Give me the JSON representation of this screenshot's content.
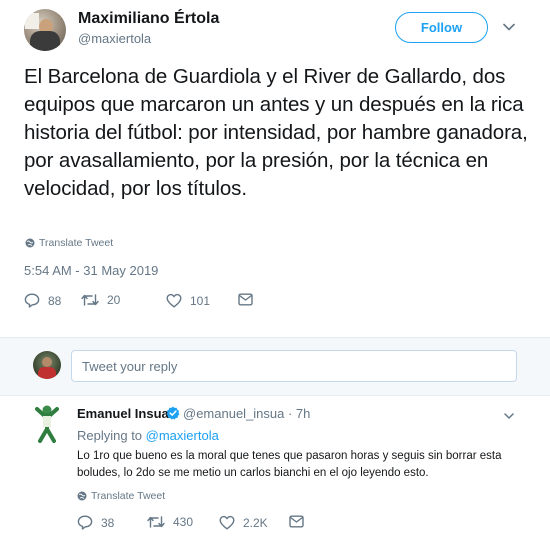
{
  "tweet": {
    "display_name": "Maximiliano Értola",
    "handle": "@maxiertola",
    "follow_label": "Follow",
    "text": "El Barcelona de Guardiola y el River de Gallardo, dos equipos que marcaron un antes y un después en la rica historia del fútbol: por intensidad, por hambre ganadora, por avasallamiento, por la presión, por la técnica en velocidad, por los títulos.",
    "translate_label": "Translate Tweet",
    "timestamp": "5:54 AM - 31 May 2019",
    "actions": {
      "replies": "88",
      "retweets": "20",
      "likes": "101"
    }
  },
  "reply_box": {
    "placeholder": "Tweet your reply"
  },
  "reply": {
    "display_name": "Emanuel Insua",
    "handle_time": "@emanuel_insua · 7h",
    "replying_prefix": "Replying to ",
    "replying_mention": "@maxiertola",
    "text": "Lo 1ro que bueno es la moral que tenes que pasaron horas y seguis sin borrar esta boludes, lo 2do se me metio un carlos bianchi en el ojo leyendo esto.",
    "translate_label": "Translate Tweet",
    "actions": {
      "replies": "38",
      "retweets": "430",
      "likes": "2.2K"
    }
  },
  "icons": {
    "reply": "reply-icon",
    "retweet": "retweet-icon",
    "like": "heart-icon",
    "dm": "envelope-icon",
    "globe": "globe-icon",
    "chevron": "chevron-down-icon",
    "verified": "verified-badge-icon"
  },
  "colors": {
    "accent": "#1da1f2",
    "secondary_text": "#657786",
    "reply_box_bg": "#f5f8fa"
  }
}
